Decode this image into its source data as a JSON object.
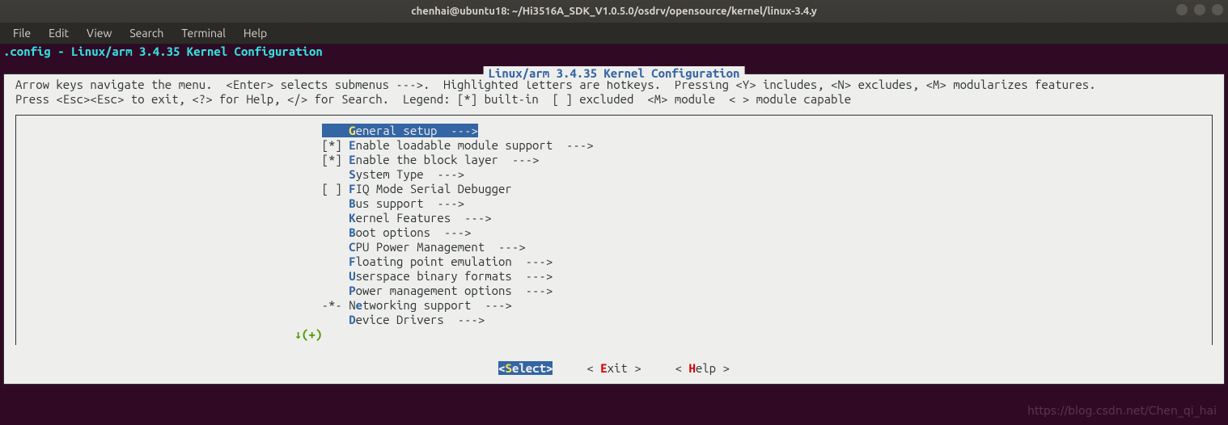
{
  "window": {
    "title": "chenhai@ubuntu18: ~/Hi3516A_SDK_V1.0.5.0/osdrv/opensource/kernel/linux-3.4.y"
  },
  "menubar": {
    "items": [
      "File",
      "Edit",
      "View",
      "Search",
      "Terminal",
      "Help"
    ]
  },
  "config_header": ".config - Linux/arm 3.4.35 Kernel Configuration",
  "frame_title": "Linux/arm 3.4.35 Kernel Configuration",
  "help_line1": "Arrow keys navigate the menu.  <Enter> selects submenus --->.  Highlighted letters are hotkeys.  Pressing <Y> includes, <N> excludes, <M> modularizes features.",
  "help_line2": "Press <Esc><Esc> to exit, <?> for Help, </> for Search.  Legend: [*] built-in  [ ] excluded  <M> module  < > module capable",
  "menu": {
    "items": [
      {
        "prefix": "    ",
        "hot": "G",
        "rest": "eneral setup  --->",
        "selected": true
      },
      {
        "prefix": "[*] ",
        "hot": "E",
        "rest": "nable loadable module support  --->"
      },
      {
        "prefix": "[*] ",
        "hot": "E",
        "rest": "nable the block layer  --->"
      },
      {
        "prefix": "    ",
        "hot": "S",
        "rest": "ystem Type  --->"
      },
      {
        "prefix": "[ ] ",
        "hot": "F",
        "rest": "IQ Mode Serial Debugger"
      },
      {
        "prefix": "    ",
        "hot": "B",
        "rest": "us support  --->"
      },
      {
        "prefix": "    ",
        "hot": "K",
        "rest": "ernel Features  --->"
      },
      {
        "prefix": "    ",
        "hot": "B",
        "rest": "oot options  --->"
      },
      {
        "prefix": "    ",
        "hot": "C",
        "rest": "PU Power Management  --->"
      },
      {
        "prefix": "    ",
        "hot": "F",
        "rest": "loating point emulation  --->"
      },
      {
        "prefix": "    ",
        "hot": "U",
        "rest": "serspace binary formats  --->"
      },
      {
        "prefix": "    ",
        "hot": "P",
        "rest": "ower management options  --->"
      },
      {
        "prefix": "-*- ",
        "hot": "e",
        "rest": "tworking support  --->",
        "pre_rest": "N"
      },
      {
        "prefix": "    ",
        "hot": "D",
        "rest": "evice Drivers  --->"
      }
    ],
    "scroll_indicator": "(+)"
  },
  "buttons": {
    "select": {
      "open": "<",
      "hot": "S",
      "rest": "elect>",
      "active": true
    },
    "exit": {
      "open": "< ",
      "hot": "E",
      "rest": "xit >"
    },
    "help": {
      "open": "< ",
      "hot": "H",
      "rest": "elp >"
    }
  },
  "watermark": "https://blog.csdn.net/Chen_qi_hai"
}
